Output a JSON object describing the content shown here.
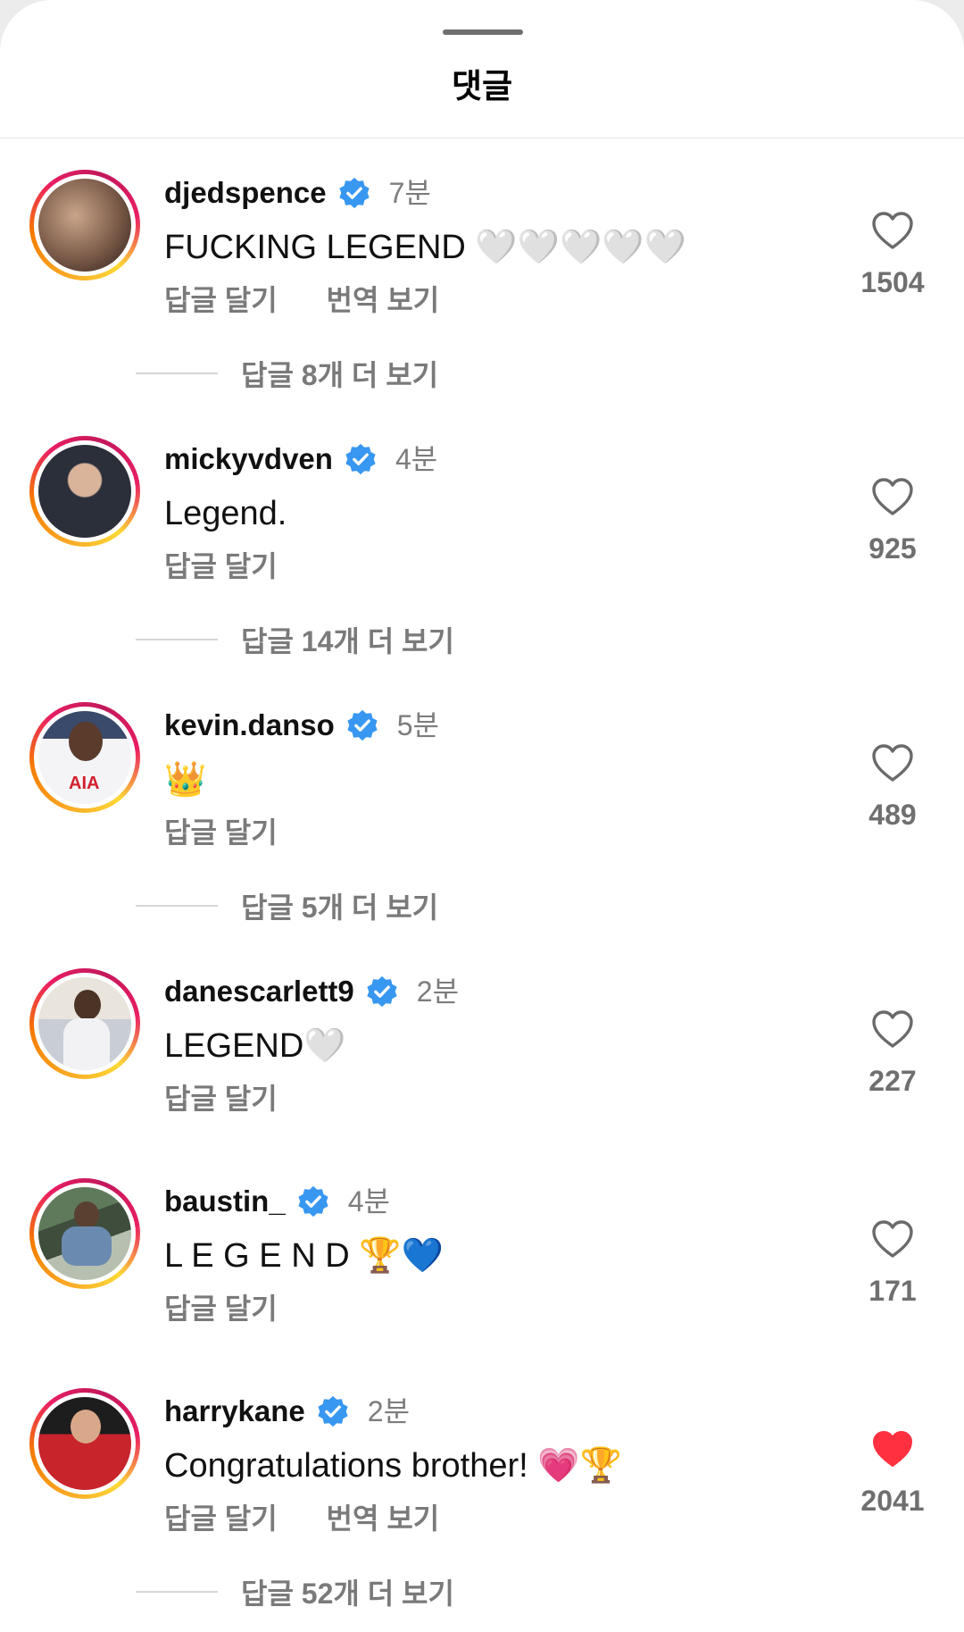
{
  "header": {
    "title": "댓글"
  },
  "colors": {
    "verified": "#3897f0",
    "liked": "#ff3040",
    "secondary_text": "#7a7a7a"
  },
  "comments": [
    {
      "username": "djedspence",
      "time": "7분",
      "text": "FUCKING LEGEND",
      "emojis": "🤍🤍🤍🤍🤍",
      "reply_label": "답글 달기",
      "translate_label": "번역 보기",
      "likes": "1504",
      "liked": false,
      "more_replies": "답글 8개 더 보기"
    },
    {
      "username": "mickyvdven",
      "time": "4분",
      "text": "Legend.",
      "emojis": "",
      "reply_label": "답글 달기",
      "likes": "925",
      "liked": false,
      "more_replies": "답글 14개 더 보기"
    },
    {
      "username": "kevin.danso",
      "time": "5분",
      "text": "",
      "emojis": "👑",
      "reply_label": "답글 달기",
      "likes": "489",
      "liked": false,
      "more_replies": "답글 5개 더 보기"
    },
    {
      "username": "danescarlett9",
      "time": "2분",
      "text": "LEGEND",
      "emojis": "🤍",
      "reply_label": "답글 달기",
      "likes": "227",
      "liked": false
    },
    {
      "username": "baustin_",
      "time": "4분",
      "text": "L E G E N D",
      "emojis": "🏆💙",
      "reply_label": "답글 달기",
      "likes": "171",
      "liked": false
    },
    {
      "username": "harrykane",
      "time": "2분",
      "text": "Congratulations brother!",
      "emojis": "💗🏆",
      "reply_label": "답글 달기",
      "translate_label": "번역 보기",
      "likes": "2041",
      "liked": true,
      "more_replies": "답글 52개 더 보기"
    }
  ]
}
